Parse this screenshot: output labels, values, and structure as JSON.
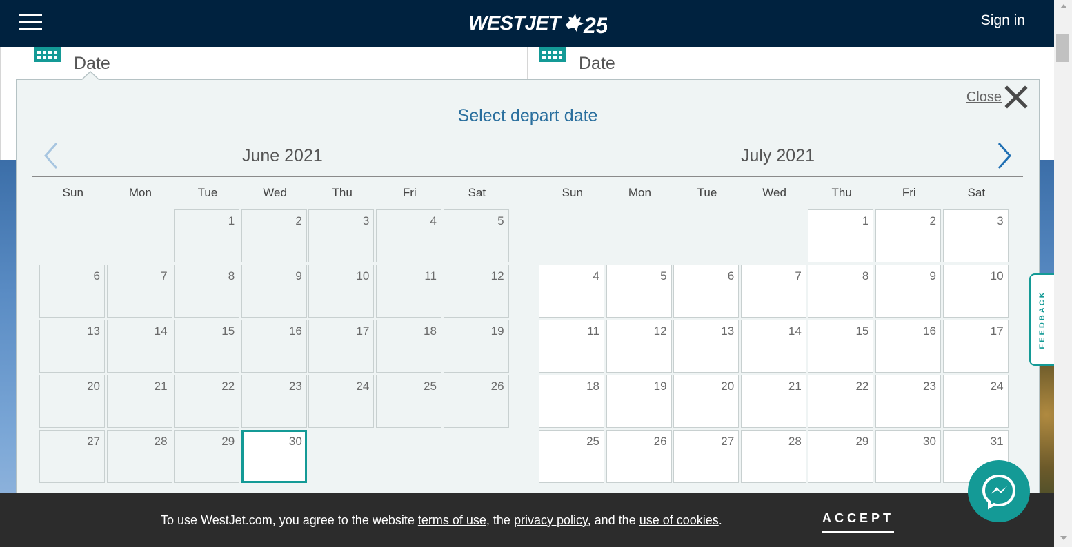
{
  "header": {
    "logo_text": "WESTJET",
    "logo_mark": "25",
    "menu_icon": "hamburger-menu-icon",
    "sign_in": "Sign in"
  },
  "form": {
    "depart_label": "Date",
    "return_label": "Date",
    "icon": "calendar-icon"
  },
  "picker": {
    "close_label": "Close",
    "title": "Select depart date",
    "weekdays": [
      "Sun",
      "Mon",
      "Tue",
      "Wed",
      "Thu",
      "Fri",
      "Sat"
    ],
    "selected_date": "June 30, 2021",
    "months": [
      {
        "title": "June 2021",
        "first_weekday": 2,
        "days": 30,
        "past_through": 29,
        "selected": 30
      },
      {
        "title": "July 2021",
        "first_weekday": 4,
        "days": 31,
        "past_through": 0,
        "selected": null
      }
    ]
  },
  "feedback": {
    "label": "FEEDBACK"
  },
  "cookie": {
    "text_before": "To use WestJet.com, you agree to the website ",
    "terms_link": "terms of use",
    "text_mid1": ", the ",
    "privacy_link": "privacy policy",
    "text_mid2": ", and the ",
    "cookies_link": "use of cookies",
    "text_after": ".",
    "accept": "ACCEPT"
  },
  "colors": {
    "nav_bg": "#00223f",
    "accent": "#149a96",
    "title_blue": "#2a6f9e",
    "picker_bg": "#eff4f4",
    "cookie_bg": "#2c2c2c"
  }
}
